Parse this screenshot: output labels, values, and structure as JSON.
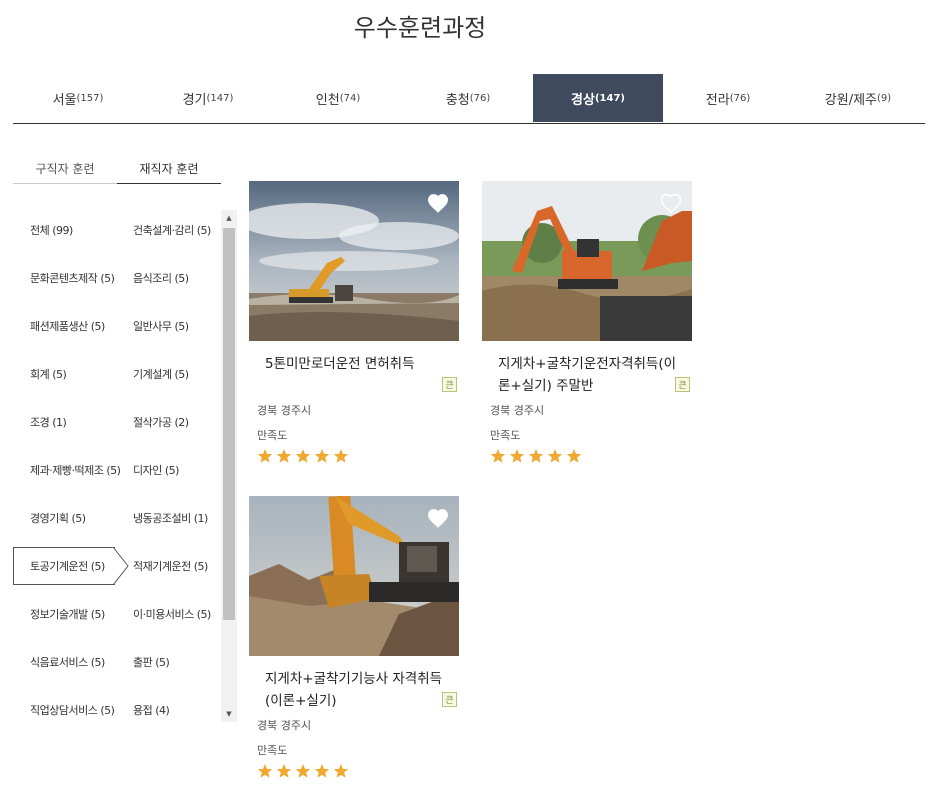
{
  "page_title": "우수훈련과정",
  "region_tabs": [
    {
      "name": "서울",
      "count": "(157)"
    },
    {
      "name": "경기",
      "count": "(147)"
    },
    {
      "name": "인천",
      "count": "(74)"
    },
    {
      "name": "충청",
      "count": "(76)"
    },
    {
      "name": "경상",
      "count": "(147)"
    },
    {
      "name": "전라",
      "count": "(76)"
    },
    {
      "name": "강원/제주",
      "count": "(9)"
    }
  ],
  "active_region": "경상",
  "sub_tabs": [
    "구직자 훈련",
    "재직자 훈련"
  ],
  "active_sub_tab": "재직자 훈련",
  "categories_left": [
    "전체 (99)",
    "문화콘텐츠제작 (5)",
    "패션제품생산 (5)",
    "회계 (5)",
    "조경 (1)",
    "제과·제빵·떡제조 (5)",
    "경영기획 (5)",
    "토공기계운전 (5)",
    "정보기술개발 (5)",
    "식음료서비스 (5)",
    "직업상담서비스 (5)"
  ],
  "categories_right": [
    "건축설계·감리 (5)",
    "음식조리 (5)",
    "일반사무 (5)",
    "기계설계 (5)",
    "절삭가공 (2)",
    "디자인 (5)",
    "냉동공조설비 (1)",
    "적재기계운전 (5)",
    "이·미용서비스 (5)",
    "출판 (5)",
    "용접 (4)"
  ],
  "selected_category": "토공기계운전 (5)",
  "scroll_icons": {
    "up": "triangle-up-icon",
    "down": "triangle-down-icon"
  },
  "courses": [
    {
      "title": "5톤미만로더운전 면허취득",
      "location": "경북 경주시",
      "satisfaction_label": "만족도",
      "rating": 5,
      "badge": "큰"
    },
    {
      "title": "지게차+굴착기운전자격취득(이론+실기) 주말반",
      "location": "경북 경주시",
      "satisfaction_label": "만족도",
      "rating": 5,
      "badge": "큰"
    },
    {
      "title": "지게차+굴착기기능사 자격취득(이론+실기)",
      "location": "경북 경주시",
      "satisfaction_label": "만족도",
      "rating": 5,
      "badge": "큰"
    }
  ],
  "colors": {
    "active_tab_bg": "#3f4a5f",
    "star": "#f0a830",
    "badge_border": "#b9c37a"
  }
}
